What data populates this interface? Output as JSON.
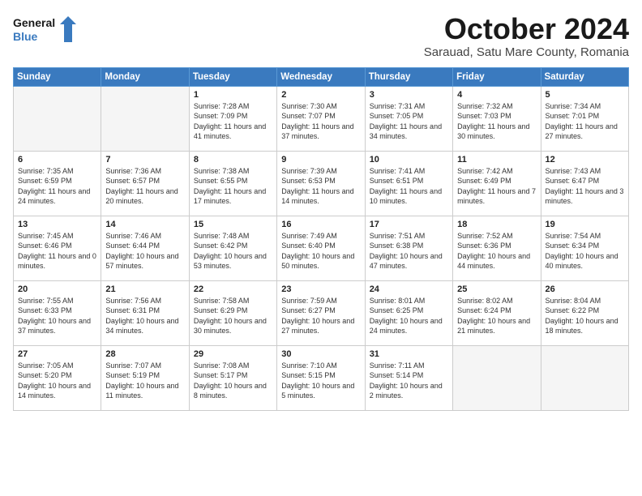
{
  "header": {
    "logo_line1": "General",
    "logo_line2": "Blue",
    "month": "October 2024",
    "location": "Sarauad, Satu Mare County, Romania"
  },
  "days_of_week": [
    "Sunday",
    "Monday",
    "Tuesday",
    "Wednesday",
    "Thursday",
    "Friday",
    "Saturday"
  ],
  "weeks": [
    [
      {
        "num": "",
        "info": ""
      },
      {
        "num": "",
        "info": ""
      },
      {
        "num": "1",
        "info": "Sunrise: 7:28 AM\nSunset: 7:09 PM\nDaylight: 11 hours and 41 minutes."
      },
      {
        "num": "2",
        "info": "Sunrise: 7:30 AM\nSunset: 7:07 PM\nDaylight: 11 hours and 37 minutes."
      },
      {
        "num": "3",
        "info": "Sunrise: 7:31 AM\nSunset: 7:05 PM\nDaylight: 11 hours and 34 minutes."
      },
      {
        "num": "4",
        "info": "Sunrise: 7:32 AM\nSunset: 7:03 PM\nDaylight: 11 hours and 30 minutes."
      },
      {
        "num": "5",
        "info": "Sunrise: 7:34 AM\nSunset: 7:01 PM\nDaylight: 11 hours and 27 minutes."
      }
    ],
    [
      {
        "num": "6",
        "info": "Sunrise: 7:35 AM\nSunset: 6:59 PM\nDaylight: 11 hours and 24 minutes."
      },
      {
        "num": "7",
        "info": "Sunrise: 7:36 AM\nSunset: 6:57 PM\nDaylight: 11 hours and 20 minutes."
      },
      {
        "num": "8",
        "info": "Sunrise: 7:38 AM\nSunset: 6:55 PM\nDaylight: 11 hours and 17 minutes."
      },
      {
        "num": "9",
        "info": "Sunrise: 7:39 AM\nSunset: 6:53 PM\nDaylight: 11 hours and 14 minutes."
      },
      {
        "num": "10",
        "info": "Sunrise: 7:41 AM\nSunset: 6:51 PM\nDaylight: 11 hours and 10 minutes."
      },
      {
        "num": "11",
        "info": "Sunrise: 7:42 AM\nSunset: 6:49 PM\nDaylight: 11 hours and 7 minutes."
      },
      {
        "num": "12",
        "info": "Sunrise: 7:43 AM\nSunset: 6:47 PM\nDaylight: 11 hours and 3 minutes."
      }
    ],
    [
      {
        "num": "13",
        "info": "Sunrise: 7:45 AM\nSunset: 6:46 PM\nDaylight: 11 hours and 0 minutes."
      },
      {
        "num": "14",
        "info": "Sunrise: 7:46 AM\nSunset: 6:44 PM\nDaylight: 10 hours and 57 minutes."
      },
      {
        "num": "15",
        "info": "Sunrise: 7:48 AM\nSunset: 6:42 PM\nDaylight: 10 hours and 53 minutes."
      },
      {
        "num": "16",
        "info": "Sunrise: 7:49 AM\nSunset: 6:40 PM\nDaylight: 10 hours and 50 minutes."
      },
      {
        "num": "17",
        "info": "Sunrise: 7:51 AM\nSunset: 6:38 PM\nDaylight: 10 hours and 47 minutes."
      },
      {
        "num": "18",
        "info": "Sunrise: 7:52 AM\nSunset: 6:36 PM\nDaylight: 10 hours and 44 minutes."
      },
      {
        "num": "19",
        "info": "Sunrise: 7:54 AM\nSunset: 6:34 PM\nDaylight: 10 hours and 40 minutes."
      }
    ],
    [
      {
        "num": "20",
        "info": "Sunrise: 7:55 AM\nSunset: 6:33 PM\nDaylight: 10 hours and 37 minutes."
      },
      {
        "num": "21",
        "info": "Sunrise: 7:56 AM\nSunset: 6:31 PM\nDaylight: 10 hours and 34 minutes."
      },
      {
        "num": "22",
        "info": "Sunrise: 7:58 AM\nSunset: 6:29 PM\nDaylight: 10 hours and 30 minutes."
      },
      {
        "num": "23",
        "info": "Sunrise: 7:59 AM\nSunset: 6:27 PM\nDaylight: 10 hours and 27 minutes."
      },
      {
        "num": "24",
        "info": "Sunrise: 8:01 AM\nSunset: 6:25 PM\nDaylight: 10 hours and 24 minutes."
      },
      {
        "num": "25",
        "info": "Sunrise: 8:02 AM\nSunset: 6:24 PM\nDaylight: 10 hours and 21 minutes."
      },
      {
        "num": "26",
        "info": "Sunrise: 8:04 AM\nSunset: 6:22 PM\nDaylight: 10 hours and 18 minutes."
      }
    ],
    [
      {
        "num": "27",
        "info": "Sunrise: 7:05 AM\nSunset: 5:20 PM\nDaylight: 10 hours and 14 minutes."
      },
      {
        "num": "28",
        "info": "Sunrise: 7:07 AM\nSunset: 5:19 PM\nDaylight: 10 hours and 11 minutes."
      },
      {
        "num": "29",
        "info": "Sunrise: 7:08 AM\nSunset: 5:17 PM\nDaylight: 10 hours and 8 minutes."
      },
      {
        "num": "30",
        "info": "Sunrise: 7:10 AM\nSunset: 5:15 PM\nDaylight: 10 hours and 5 minutes."
      },
      {
        "num": "31",
        "info": "Sunrise: 7:11 AM\nSunset: 5:14 PM\nDaylight: 10 hours and 2 minutes."
      },
      {
        "num": "",
        "info": ""
      },
      {
        "num": "",
        "info": ""
      }
    ]
  ]
}
